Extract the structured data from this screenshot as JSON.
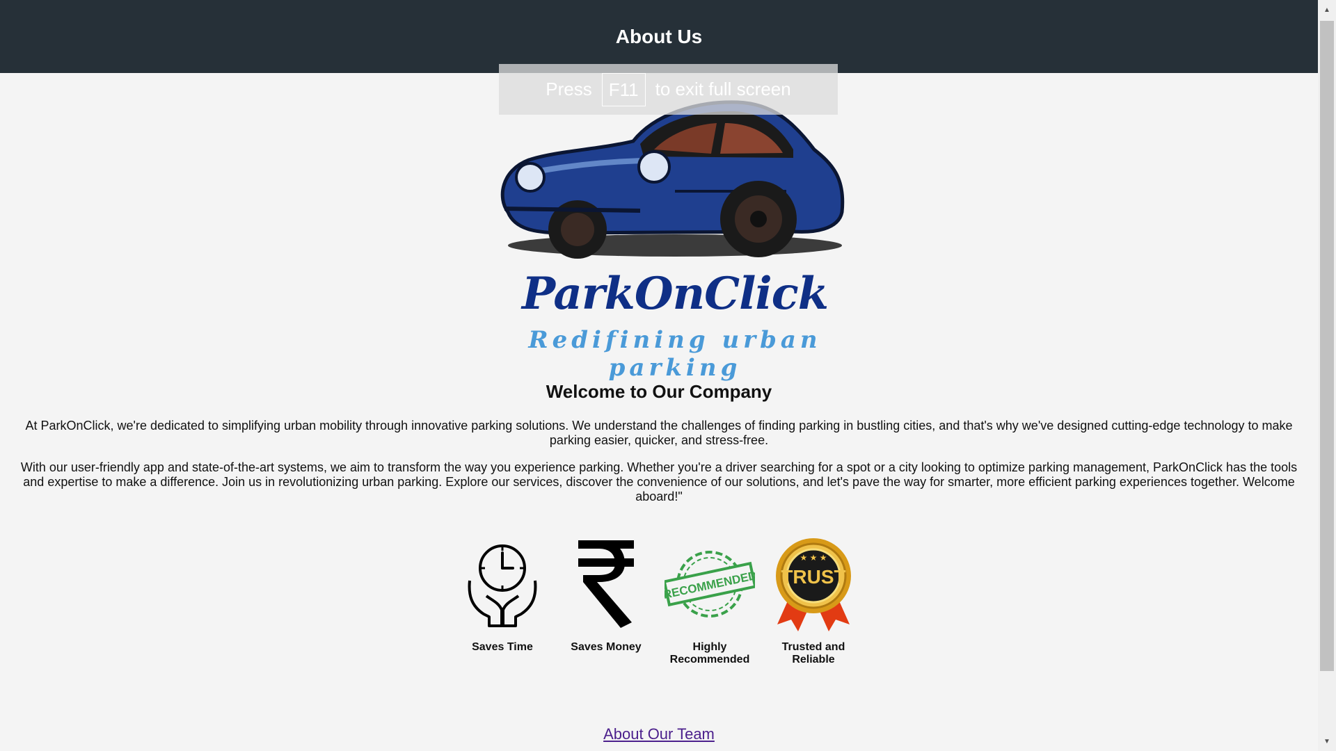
{
  "header": {
    "title": "About Us",
    "bg_color": "#263038"
  },
  "fullscreen_notice": {
    "press": "Press",
    "key": "F11",
    "rest": "to exit full screen"
  },
  "logo": {
    "name": "ParkOnClick",
    "tagline": "Redifining urban parking",
    "car_color": "#1f3f8f"
  },
  "content": {
    "welcome_heading": "Welcome to Our Company",
    "paragraph_1": "At ParkOnClick, we're dedicated to simplifying urban mobility through innovative parking solutions. We understand the challenges of finding parking in bustling cities, and that's why we've designed cutting-edge technology to make parking easier, quicker, and stress-free.",
    "paragraph_2": "With our user-friendly app and state-of-the-art systems, we aim to transform the way you experience parking. Whether you're a driver searching for a spot or a city looking to optimize parking management, ParkOnClick has the tools and expertise to make a difference. Join us in revolutionizing urban parking. Explore our services, discover the convenience of our solutions, and let's pave the way for smarter, more efficient parking experiences together. Welcome aboard!\""
  },
  "features": [
    {
      "label": "Saves Time",
      "icon": "clock-hands-icon"
    },
    {
      "label": "Saves Money",
      "icon": "rupee-icon"
    },
    {
      "label": "Highly Recommended",
      "icon": "recommended-stamp-icon",
      "stamp_text": "RECOMMENDED"
    },
    {
      "label": "Trusted and Reliable",
      "icon": "trust-badge-icon",
      "badge_text": "TRUST"
    }
  ],
  "team_link": {
    "label": "About Our Team",
    "color": "#4b1f8c"
  }
}
